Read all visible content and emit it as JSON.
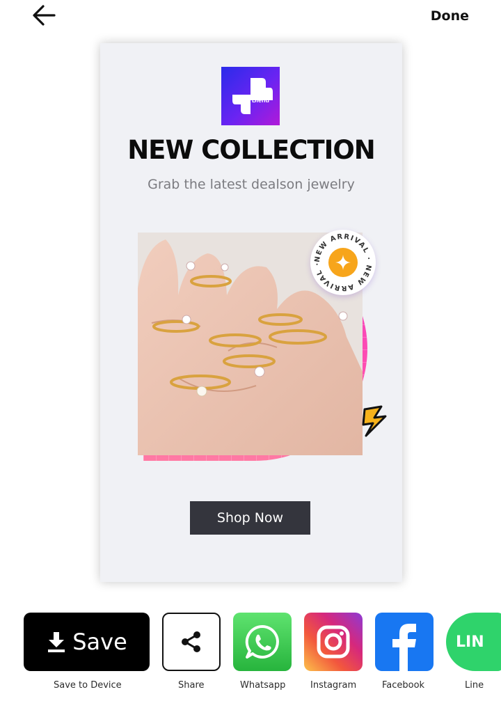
{
  "header": {
    "done_label": "Done"
  },
  "card": {
    "logo_text": "Blend",
    "headline": "NEW COLLECTION",
    "subline": "Grab the latest dealson jewelry",
    "badge_text": "NEW ARRIVAL · NEW ARRIVAL ·",
    "shop_button_label": "Shop Now",
    "accent_colors": {
      "blob": "#f03ac6",
      "badge_center": "#f7a51b",
      "button": "#34353d",
      "logo": "#5a27ef"
    }
  },
  "share": {
    "save_button_label": "Save",
    "items": [
      {
        "label": "Save to Device"
      },
      {
        "label": "Share"
      },
      {
        "label": "Whatsapp"
      },
      {
        "label": "Instagram"
      },
      {
        "label": "Facebook"
      },
      {
        "label": "Line"
      }
    ],
    "line_tile_text": "LIN"
  }
}
